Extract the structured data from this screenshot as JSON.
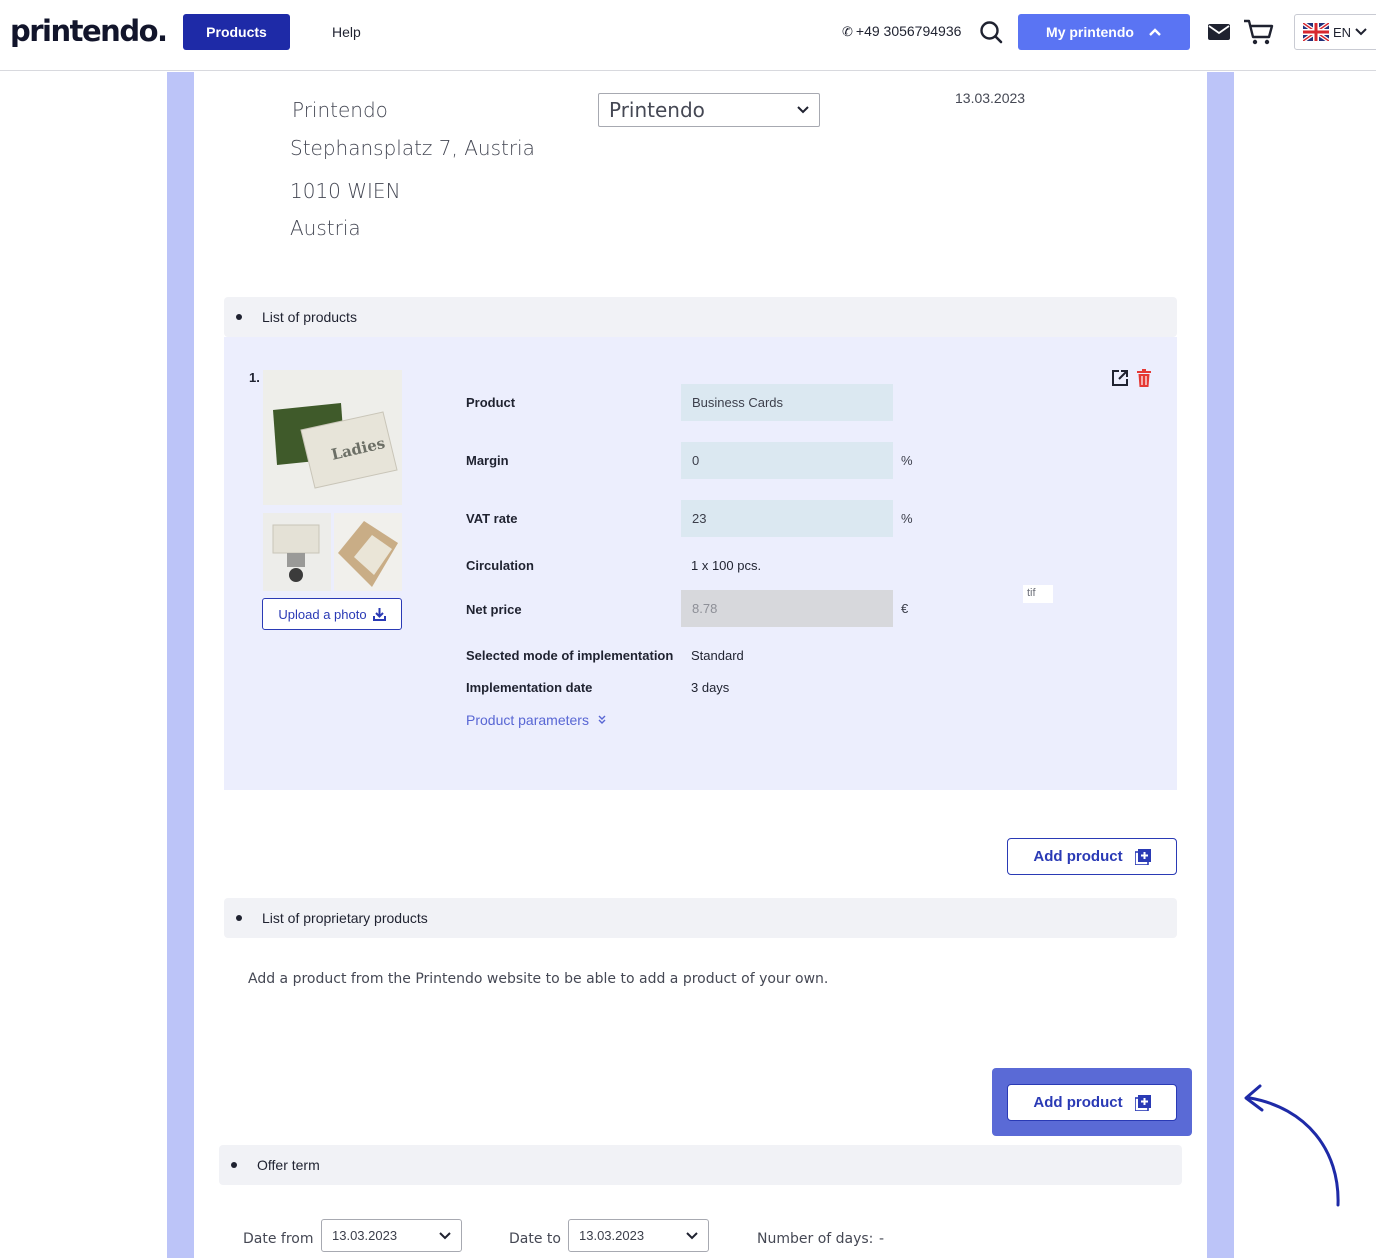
{
  "header": {
    "logo": "printendo.",
    "products_label": "Products",
    "help_label": "Help",
    "phone": "+49 3056794936",
    "my_printendo_label": "My printendo",
    "language": "EN"
  },
  "address": {
    "company": "Printendo",
    "street": "Stephansplatz 7, Austria",
    "city": "1010 WIEN",
    "country": "Austria"
  },
  "company_select": {
    "value": "Printendo"
  },
  "date": "13.03.2023",
  "sections": {
    "products": "List of products",
    "proprietary": "List of proprietary products",
    "offer_term": "Offer term"
  },
  "product": {
    "index": "1.",
    "upload_label": "Upload a photo",
    "labels": {
      "product": "Product",
      "margin": "Margin",
      "vat": "VAT rate",
      "circulation": "Circulation",
      "net_price": "Net price",
      "mode": "Selected mode of implementation",
      "impl_date": "Implementation date"
    },
    "values": {
      "product": "Business Cards",
      "margin": "0",
      "vat": "23",
      "circulation": "1 x 100 pcs.",
      "net_price": "8.78",
      "mode": "Standard",
      "impl_date": "3 days"
    },
    "units": {
      "percent": "%",
      "currency": "€"
    },
    "file_type": "tif",
    "params_link": "Product parameters",
    "image_text": "Ladies"
  },
  "add_product_label": "Add product",
  "proprietary_note": "Add a product from the Printendo website to be able to add a product of your own.",
  "offer": {
    "date_from_label": "Date from",
    "date_from": "13.03.2023",
    "date_to_label": "Date to",
    "date_to": "13.03.2023",
    "days_label": "Number of days:",
    "days_value": "-"
  },
  "colors": {
    "brand_dark": "#1e2aa7",
    "brand_accent": "#5a74f3",
    "frame": "#bcc4f8",
    "card_bg": "#eceefd",
    "highlight": "#5a6ad6"
  },
  "icons": [
    "phone-icon",
    "search-icon",
    "chevron-up-icon",
    "mail-icon",
    "cart-icon",
    "uk-flag-icon",
    "chevron-down-icon",
    "external-link-icon",
    "trash-icon",
    "download-icon",
    "add-square-icon",
    "double-chevron-down-icon",
    "curved-arrow-icon"
  ]
}
